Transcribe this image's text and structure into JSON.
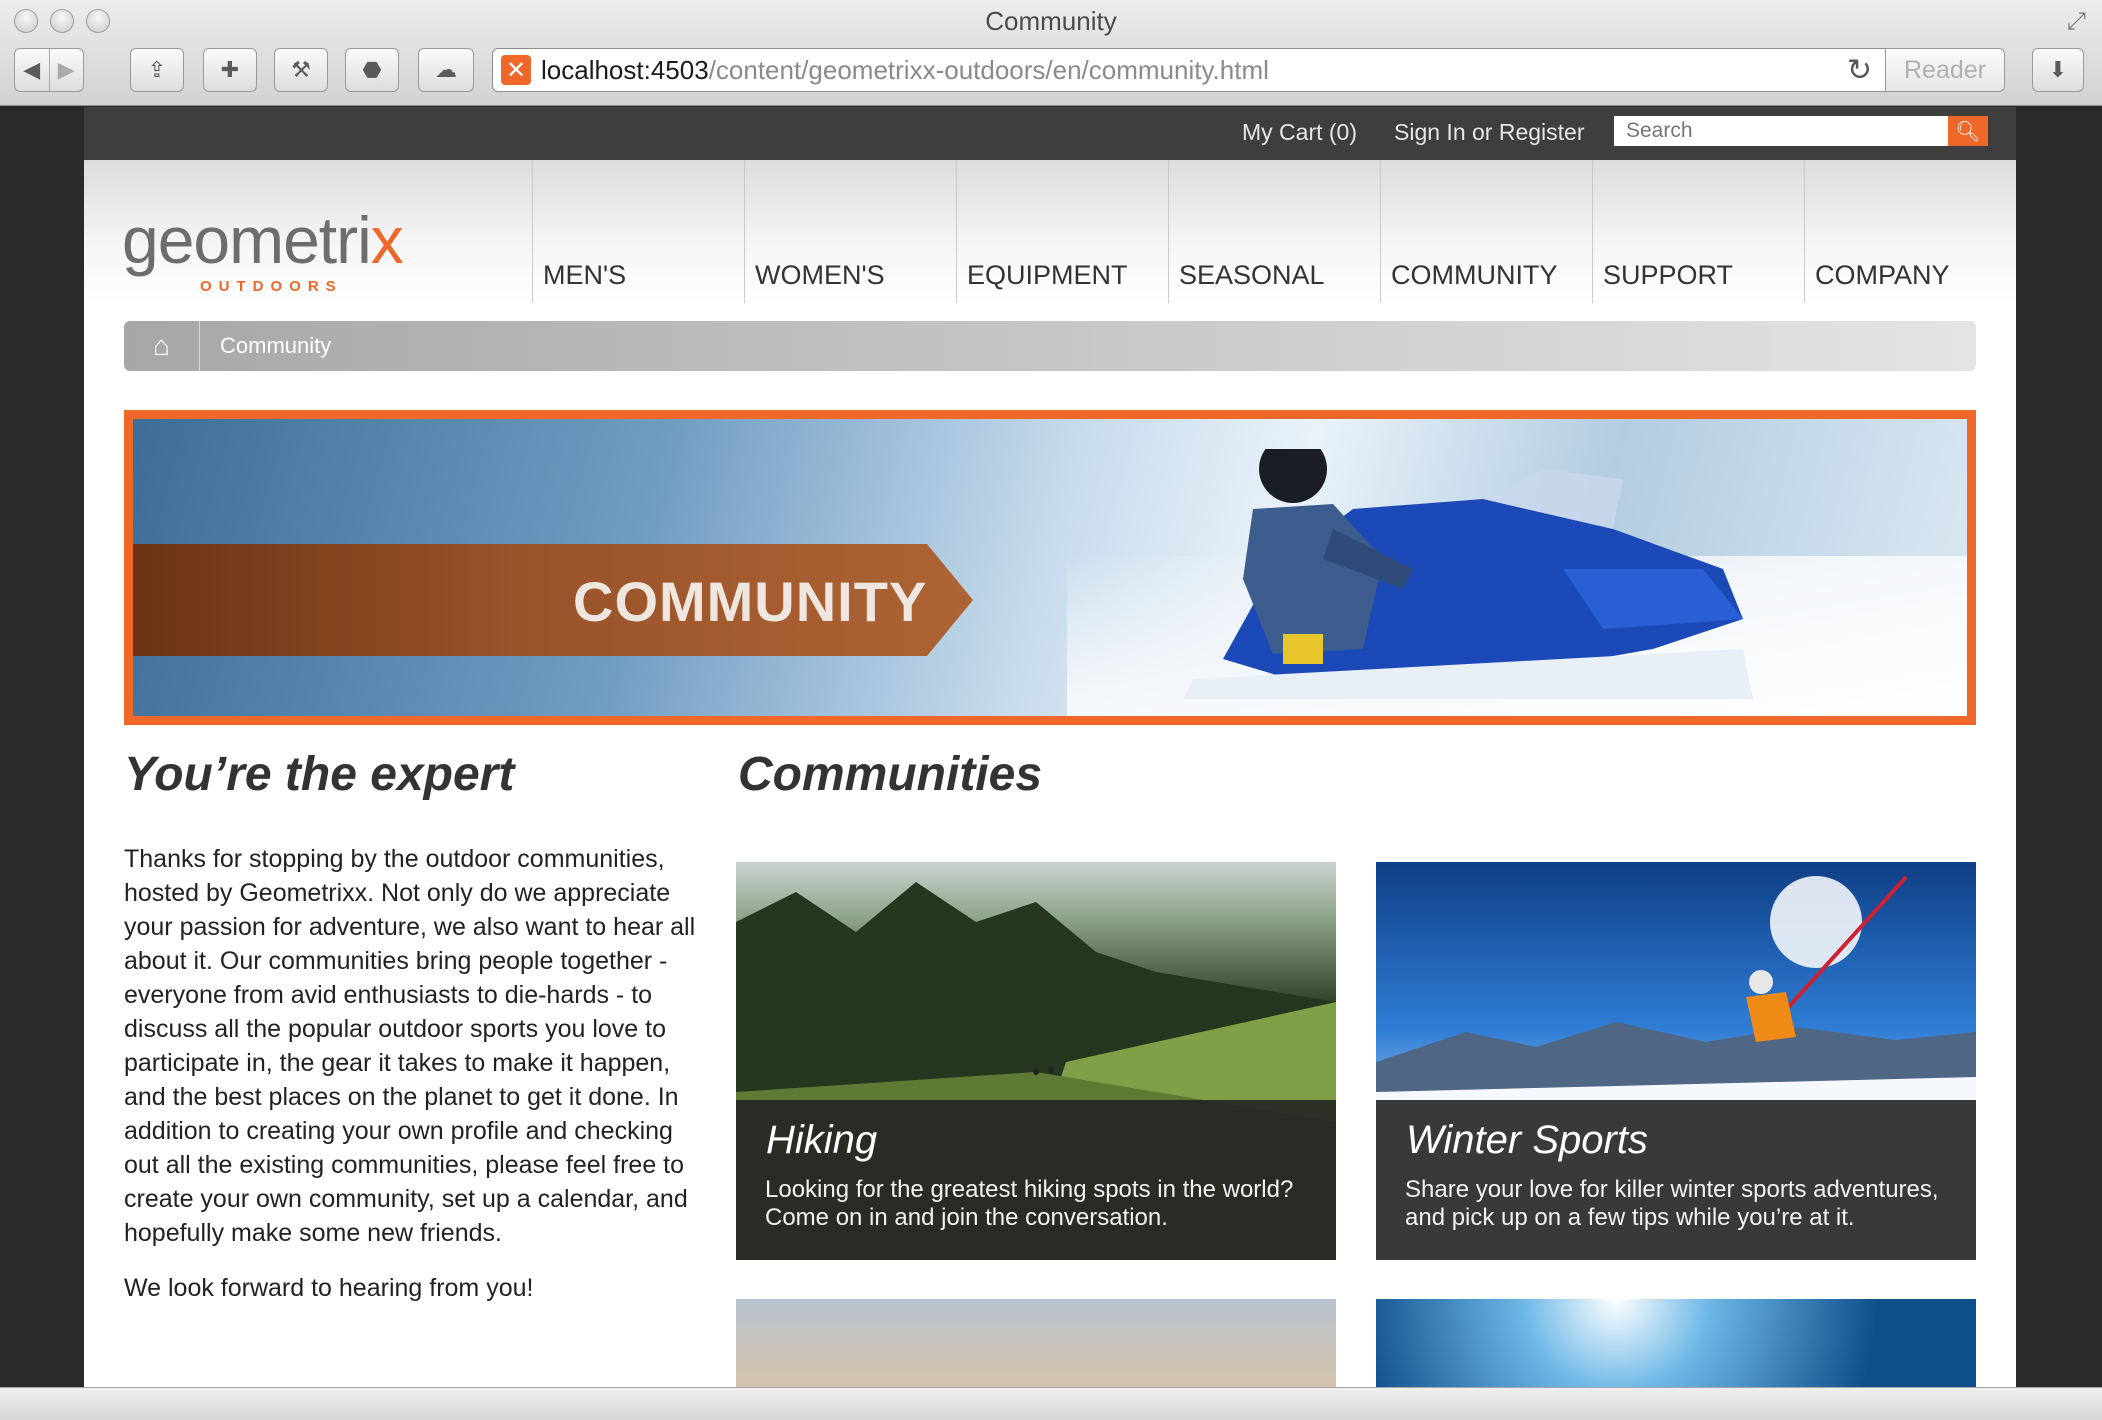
{
  "browser": {
    "window_title": "Community",
    "url_host": "localhost:4503",
    "url_path": "/content/geometrixx-outdoors/en/community.html",
    "reader_label": "Reader"
  },
  "topbar": {
    "cart_label": "My Cart (0)",
    "signin_label": "Sign In or Register",
    "search_placeholder": "Search"
  },
  "logo": {
    "word": "geometri",
    "x_mark": "x",
    "tagline": "OUTDOORS"
  },
  "nav": {
    "items": [
      {
        "label": "MEN'S"
      },
      {
        "label": "WOMEN'S"
      },
      {
        "label": "EQUIPMENT"
      },
      {
        "label": "SEASONAL"
      },
      {
        "label": "COMMUNITY"
      },
      {
        "label": "SUPPORT"
      },
      {
        "label": "COMPANY"
      }
    ]
  },
  "breadcrumb": {
    "current": "Community"
  },
  "hero": {
    "title": "COMMUNITY"
  },
  "intro": {
    "heading": "You’re the expert",
    "body": "Thanks for stopping by the outdoor communities, hosted by Geometrixx. Not only do we appreciate your passion for adventure, we also want to hear all about it. Our communities bring people together - everyone from avid enthusiasts to die-hards - to discuss all the popular outdoor sports you love to participate in, the gear it takes to make it happen, and the best places on the planet to get it done. In addition to creating your own profile and checking out all the existing communities, please feel free to create your own community, set up a calendar, and hopefully make some new friends.",
    "closing": "We look forward to hearing from you!"
  },
  "communities": {
    "heading": "Communities",
    "cards": [
      {
        "title": "Hiking",
        "description": "Looking for the greatest hiking spots in the world? Come on in and join the conversation."
      },
      {
        "title": "Winter Sports",
        "description": "Share your love for killer winter sports adventures, and pick up on a few tips while you’re at it."
      }
    ]
  },
  "colors": {
    "accent": "#f0672a",
    "topbar": "#3e3e3e",
    "text": "#333333"
  }
}
